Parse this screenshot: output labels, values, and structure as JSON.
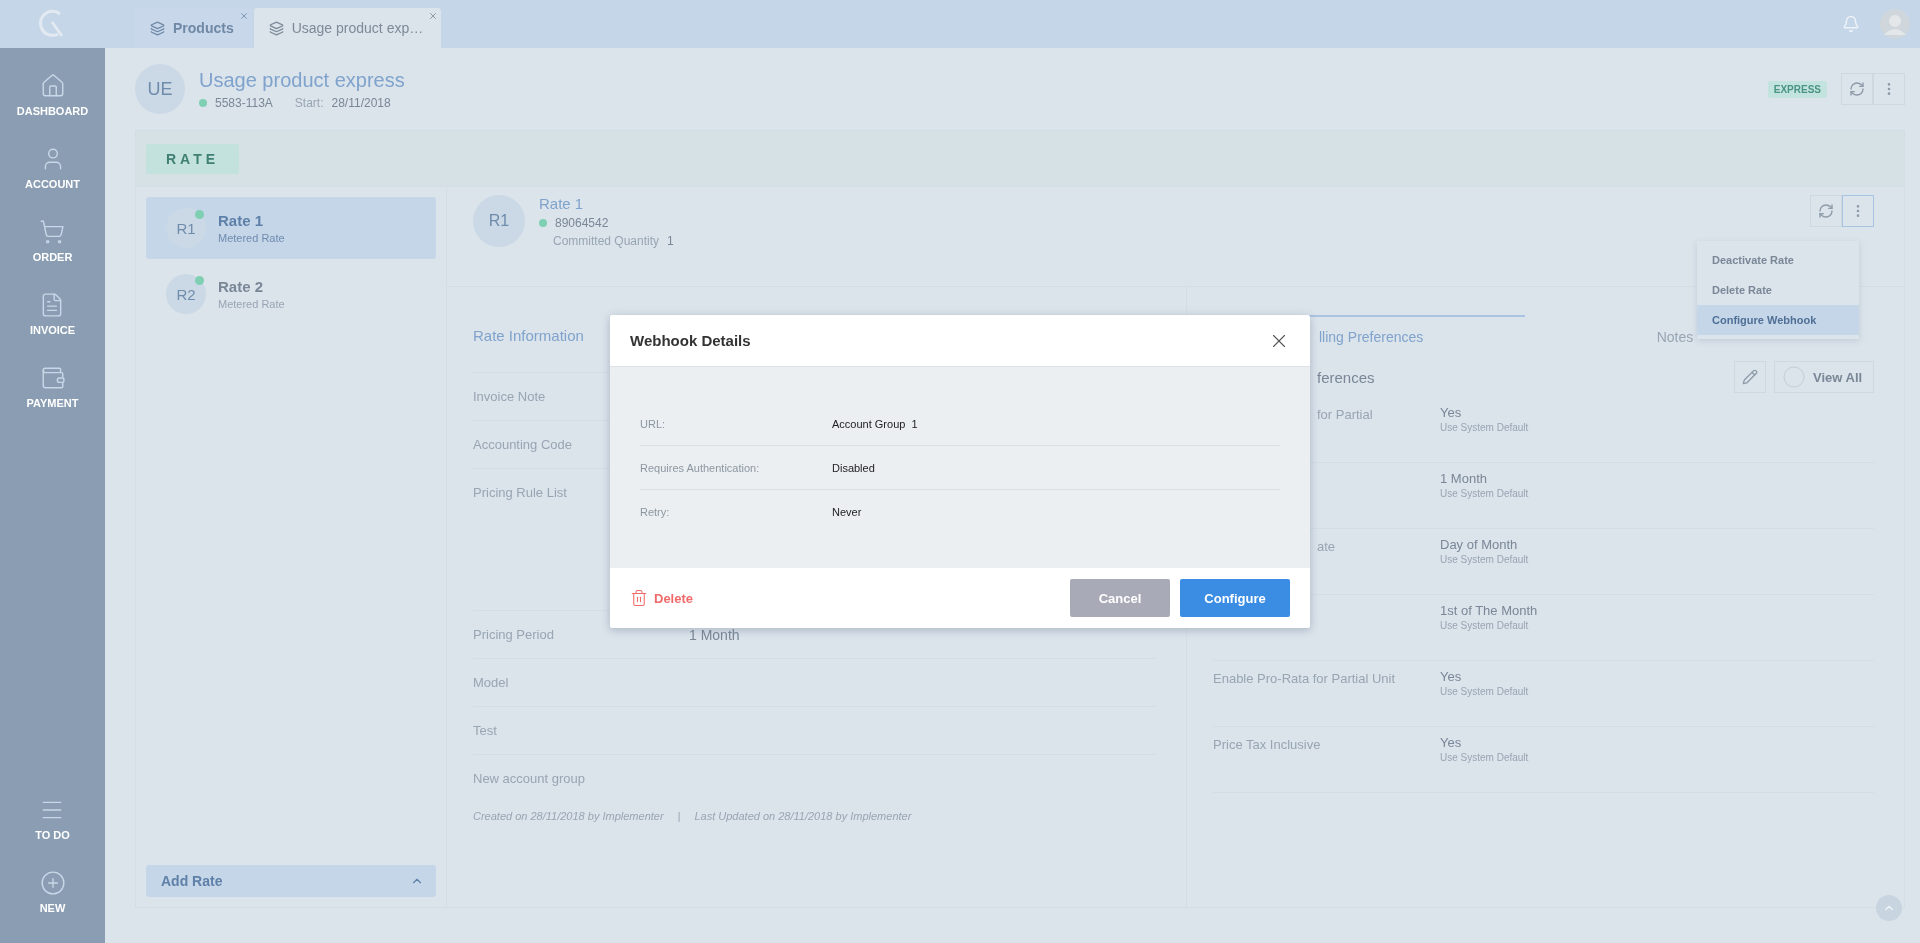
{
  "tabs": [
    {
      "label": "Products",
      "selected": false
    },
    {
      "label": "Usage product exp…",
      "selected": true
    }
  ],
  "sidebar": {
    "items": [
      {
        "label": "DASHBOARD"
      },
      {
        "label": "ACCOUNT"
      },
      {
        "label": "ORDER"
      },
      {
        "label": "INVOICE"
      },
      {
        "label": "PAYMENT"
      }
    ],
    "bottom_items": [
      {
        "label": "TO DO"
      },
      {
        "label": "NEW"
      }
    ]
  },
  "product": {
    "avatar": "UE",
    "title": "Usage product express",
    "id": "5583-113A",
    "start_label": "Start:",
    "start_date": "28/11/2018",
    "badge": "EXPRESS"
  },
  "section_tab": "RATE",
  "rates": [
    {
      "avatar": "R1",
      "name": "Rate 1",
      "type": "Metered Rate",
      "selected": true
    },
    {
      "avatar": "R2",
      "name": "Rate 2",
      "type": "Metered Rate",
      "selected": false
    }
  ],
  "add_rate": "Add Rate",
  "rate_detail": {
    "avatar": "R1",
    "name": "Rate 1",
    "id": "89064542",
    "committed_label": "Committed Quantity",
    "committed_value": "1"
  },
  "menu": {
    "items": [
      {
        "label": "Deactivate Rate",
        "selected": false
      },
      {
        "label": "Delete Rate",
        "selected": false
      },
      {
        "label": "Configure Webhook",
        "selected": true
      }
    ]
  },
  "rate_information": {
    "title": "Rate Information",
    "rows": [
      {
        "label": "Invoice Note",
        "kind": "field"
      },
      {
        "label": "Accounting Code",
        "kind": "field"
      },
      {
        "label": "Pricing Rule List",
        "kind": "list"
      },
      {
        "label": "Pricing Period",
        "kind": "field",
        "value": "1 Month"
      },
      {
        "label": "Model",
        "kind": "field"
      },
      {
        "label": "Test",
        "kind": "field"
      },
      {
        "label": "New account group",
        "kind": "field"
      }
    ],
    "created": "Created on 28/11/2018 by Implementer",
    "separator": "|",
    "updated": "Last Updated on 28/11/2018 by Implementer"
  },
  "billing": {
    "tabs": [
      {
        "label": "lling Preferences",
        "selected": true
      },
      {
        "label": "Notes",
        "selected": false
      }
    ],
    "section_title": "ferences",
    "view_all": "View All",
    "rows": [
      {
        "label": "for Partial",
        "clipped": true,
        "value": "Yes",
        "note": "Use System Default"
      },
      {
        "value": "1 Month",
        "note": "Use System Default"
      },
      {
        "label": "ate",
        "clipped": true,
        "value": "Day of Month",
        "note": "Use System Default"
      },
      {
        "value": "1st of The Month",
        "note": "Use System Default"
      },
      {
        "label": "Enable Pro-Rata for Partial Unit",
        "value": "Yes",
        "note": "Use System Default"
      },
      {
        "label": "Price Tax Inclusive",
        "value": "Yes",
        "note": "Use System Default"
      }
    ]
  },
  "dialog": {
    "title": "Webhook Details",
    "rows": [
      {
        "label": "URL:",
        "value": "Account Group  1"
      },
      {
        "label": "Requires Authentication:",
        "value": "Disabled"
      },
      {
        "label": "Retry:",
        "value": "Never"
      }
    ],
    "delete": "Delete",
    "cancel": "Cancel",
    "confirm": "Configure"
  }
}
